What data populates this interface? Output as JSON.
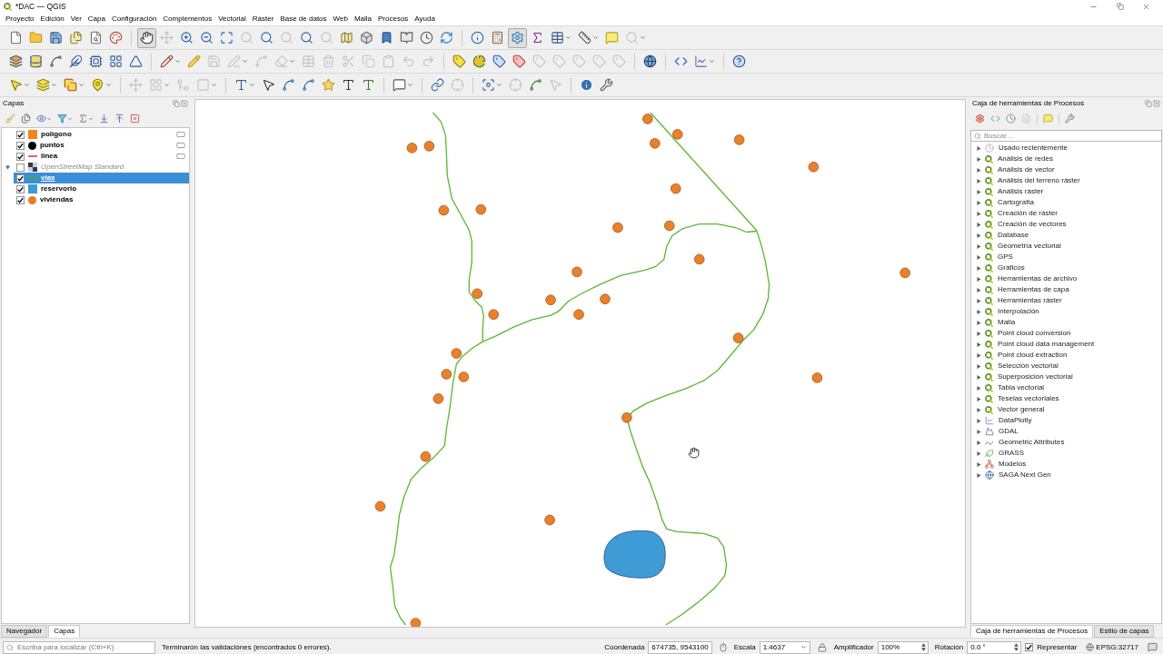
{
  "window": {
    "title": "*DAC — QGIS"
  },
  "menu": [
    "Proyecto",
    "Edición",
    "Ver",
    "Capa",
    "Configuración",
    "Complementos",
    "Vectorial",
    "Ráster",
    "Base de datos",
    "Web",
    "Malla",
    "Procesos",
    "Ayuda"
  ],
  "toolbars": [
    {
      "items": [
        {
          "disabled": false,
          "active": false
        },
        {
          "disabled": false,
          "active": false
        },
        {
          "disabled": false,
          "active": false
        },
        {
          "disabled": false,
          "active": false
        },
        {
          "disabled": false,
          "active": false
        },
        {
          "disabled": false,
          "active": false
        },
        {
          "disabled": false,
          "active": true
        },
        {
          "disabled": true,
          "active": false
        },
        {
          "disabled": false,
          "active": false
        },
        {
          "disabled": false,
          "active": false
        },
        {
          "disabled": false,
          "active": false
        },
        {
          "disabled": true,
          "active": false
        },
        {
          "disabled": false,
          "active": false
        },
        {
          "disabled": true,
          "active": false
        },
        {
          "disabled": false,
          "active": false
        },
        {
          "disabled": true,
          "active": false
        },
        {
          "disabled": false,
          "active": false
        },
        {
          "disabled": false,
          "active": false
        },
        {
          "disabled": false,
          "active": false
        },
        {
          "disabled": false,
          "active": false
        },
        {
          "disabled": false,
          "active": false
        },
        {
          "disabled": false,
          "active": false
        },
        {
          "disabled": false,
          "active": false
        },
        {
          "disabled": false,
          "active": false
        },
        {
          "disabled": false,
          "active": true
        },
        {
          "disabled": false,
          "active": false
        },
        {
          "disabled": false,
          "active": false
        },
        {
          "disabled": false,
          "active": false
        },
        {
          "disabled": false,
          "active": false
        },
        {
          "disabled": true,
          "active": false
        }
      ]
    },
    {
      "items": [
        {
          "disabled": false,
          "active": false
        },
        {
          "disabled": false,
          "active": false
        },
        {
          "disabled": false,
          "active": false
        },
        {
          "disabled": false,
          "active": false
        },
        {
          "disabled": false,
          "active": false
        },
        {
          "disabled": false,
          "active": false
        },
        {
          "disabled": false,
          "active": false
        },
        {
          "disabled": false,
          "active": false
        },
        {
          "disabled": false,
          "active": false
        },
        {
          "disabled": true,
          "active": false
        },
        {
          "disabled": true,
          "active": false
        },
        {
          "disabled": true,
          "active": false
        },
        {
          "disabled": true,
          "active": false
        },
        {
          "disabled": true,
          "active": false
        },
        {
          "disabled": true,
          "active": false
        },
        {
          "disabled": true,
          "active": false
        },
        {
          "disabled": true,
          "active": false
        },
        {
          "disabled": true,
          "active": false
        },
        {
          "disabled": true,
          "active": false
        },
        {
          "disabled": true,
          "active": false
        },
        {
          "disabled": false,
          "active": false
        },
        {
          "disabled": false,
          "active": false
        },
        {
          "disabled": false,
          "active": false
        },
        {
          "disabled": false,
          "active": false
        },
        {
          "disabled": true,
          "active": false
        },
        {
          "disabled": true,
          "active": false
        },
        {
          "disabled": true,
          "active": false
        },
        {
          "disabled": true,
          "active": false
        },
        {
          "disabled": true,
          "active": false
        },
        {
          "disabled": false,
          "active": false
        },
        {
          "disabled": false,
          "active": false
        },
        {
          "disabled": false,
          "active": false
        },
        {
          "disabled": false,
          "active": false
        }
      ]
    },
    {
      "items": [
        {
          "disabled": false,
          "active": false
        },
        {
          "disabled": false,
          "active": false
        },
        {
          "disabled": false,
          "active": false
        },
        {
          "disabled": false,
          "active": false
        },
        {
          "disabled": true,
          "active": false
        },
        {
          "disabled": true,
          "active": false
        },
        {
          "disabled": true,
          "active": false
        },
        {
          "disabled": true,
          "active": false
        },
        {
          "disabled": false,
          "active": false
        },
        {
          "disabled": false,
          "active": false
        },
        {
          "disabled": false,
          "active": false
        },
        {
          "disabled": false,
          "active": false
        },
        {
          "disabled": false,
          "active": false
        },
        {
          "disabled": false,
          "active": false
        },
        {
          "disabled": false,
          "active": false
        },
        {
          "disabled": false,
          "active": false
        },
        {
          "disabled": false,
          "active": false
        },
        {
          "disabled": true,
          "active": false
        },
        {
          "disabled": false,
          "active": false
        },
        {
          "disabled": true,
          "active": false
        },
        {
          "disabled": false,
          "active": false
        },
        {
          "disabled": true,
          "active": false
        },
        {
          "disabled": false,
          "active": false
        },
        {
          "disabled": false,
          "active": false
        }
      ]
    }
  ],
  "layers_panel": {
    "title": "Capas",
    "layers": [
      {
        "name": "poligono",
        "checked": true,
        "selected": false,
        "kind": "fill",
        "color": "#f0861c",
        "indicator": true
      },
      {
        "name": "puntos",
        "checked": true,
        "selected": false,
        "kind": "marker",
        "color": "#000000",
        "indicator": true
      },
      {
        "name": "linea",
        "checked": true,
        "selected": false,
        "kind": "line",
        "color": "#d06a6a",
        "indicator": true
      },
      {
        "name": "OpenStreetMap Standard",
        "checked": false,
        "selected": false,
        "kind": "raster",
        "indicator": false,
        "expanded": true
      },
      {
        "name": "vias",
        "checked": true,
        "selected": true,
        "kind": "line",
        "color": "#4fa83a",
        "indicator": false
      },
      {
        "name": "reservorio",
        "checked": true,
        "selected": false,
        "kind": "fill",
        "color": "#3d9bd6",
        "indicator": false
      },
      {
        "name": "viviendas",
        "checked": true,
        "selected": false,
        "kind": "marker",
        "color": "#e67e22",
        "indicator": false
      }
    ],
    "tabs": [
      {
        "label": "Navegador",
        "selected": false
      },
      {
        "label": "Capas",
        "selected": true
      }
    ]
  },
  "processing_panel": {
    "title": "Caja de herramientas de Procesos",
    "tools": [
      {
        "disabled": false
      },
      {
        "disabled": false
      },
      {
        "disabled": false
      },
      {
        "disabled": true
      },
      {
        "disabled": false
      },
      {
        "disabled": false
      }
    ],
    "search": {
      "placeholder": "Buscar…"
    },
    "providers": [
      {
        "label": "Usado recientemente",
        "kind": "recent",
        "expanded": false
      },
      {
        "label": "Análisis de redes",
        "kind": "native",
        "expanded": false
      },
      {
        "label": "Análisis de vector",
        "kind": "native",
        "expanded": false
      },
      {
        "label": "Análisis del terreno ráster",
        "kind": "native",
        "expanded": false
      },
      {
        "label": "Análisis ráster",
        "kind": "native",
        "expanded": false
      },
      {
        "label": "Cartografía",
        "kind": "native",
        "expanded": false
      },
      {
        "label": "Creación de ráster",
        "kind": "native",
        "expanded": false
      },
      {
        "label": "Creación de vectores",
        "kind": "native",
        "expanded": false
      },
      {
        "label": "Database",
        "kind": "native",
        "expanded": false
      },
      {
        "label": "Geometría vectorial",
        "kind": "native",
        "expanded": false
      },
      {
        "label": "GPS",
        "kind": "native",
        "expanded": false
      },
      {
        "label": "Gráficos",
        "kind": "native",
        "expanded": false
      },
      {
        "label": "Herramientas de archivo",
        "kind": "native",
        "expanded": false
      },
      {
        "label": "Herramientas de capa",
        "kind": "native",
        "expanded": false
      },
      {
        "label": "Herramientas ráster",
        "kind": "native",
        "expanded": false
      },
      {
        "label": "Interpolación",
        "kind": "native",
        "expanded": false
      },
      {
        "label": "Malla",
        "kind": "native",
        "expanded": false
      },
      {
        "label": "Point cloud conversion",
        "kind": "native",
        "expanded": false
      },
      {
        "label": "Point cloud data management",
        "kind": "native",
        "expanded": false
      },
      {
        "label": "Point cloud extraction",
        "kind": "native",
        "expanded": false
      },
      {
        "label": "Selección vectorial",
        "kind": "native",
        "expanded": false
      },
      {
        "label": "Superposición vectorial",
        "kind": "native",
        "expanded": false
      },
      {
        "label": "Tabla vectorial",
        "kind": "native",
        "expanded": false
      },
      {
        "label": "Teselas vectoriales",
        "kind": "native",
        "expanded": false
      },
      {
        "label": "Vector general",
        "kind": "native",
        "expanded": false
      },
      {
        "label": "DataPlotly",
        "kind": "dataplotly",
        "expanded": false
      },
      {
        "label": "GDAL",
        "kind": "gdal",
        "expanded": false
      },
      {
        "label": "Geometric Attributes",
        "kind": "geometric",
        "expanded": false
      },
      {
        "label": "GRASS",
        "kind": "grass",
        "expanded": false
      },
      {
        "label": "Modelos",
        "kind": "model",
        "expanded": false
      },
      {
        "label": "SAGA Next Gen",
        "kind": "saga",
        "expanded": false
      }
    ],
    "tabs": [
      {
        "label": "Caja de herramientas de Procesos",
        "selected": true
      },
      {
        "label": "Estilo de capas",
        "selected": false
      }
    ]
  },
  "status_bar": {
    "locator": {
      "placeholder": "Escriba para localizar (Ctrl+K)"
    },
    "message": "Terminarón las validaciónes (encontrados 0 errores).",
    "coordinate": {
      "label": "Coordenada",
      "value": "674735, 9543100"
    },
    "scale": {
      "label": "Escala",
      "value": "1:4637"
    },
    "magnifier": {
      "label": "Amplificador",
      "value": "100%"
    },
    "rotation": {
      "label": "Rotación",
      "value": "0.0 °"
    },
    "render": {
      "label": "Representar",
      "checked": true
    },
    "crs": "EPSG:32717"
  }
}
